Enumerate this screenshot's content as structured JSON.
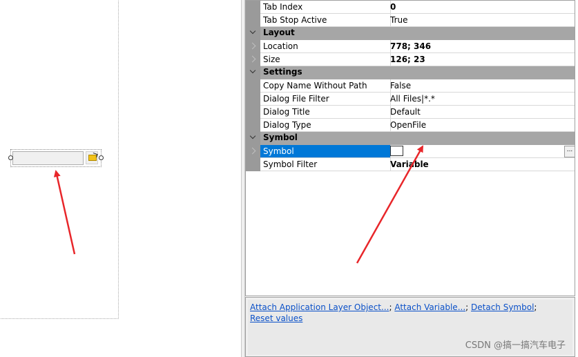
{
  "properties": {
    "rows": [
      {
        "kind": "prop",
        "name": "Tab Index",
        "value": "0",
        "bold": true
      },
      {
        "kind": "prop",
        "name": "Tab Stop Active",
        "value": "True",
        "bold": false
      },
      {
        "kind": "category",
        "name": "Layout"
      },
      {
        "kind": "prop",
        "name": "Location",
        "value": "778; 346",
        "bold": true,
        "expandable": true
      },
      {
        "kind": "prop",
        "name": "Size",
        "value": "126; 23",
        "bold": true,
        "expandable": true
      },
      {
        "kind": "category",
        "name": "Settings"
      },
      {
        "kind": "prop",
        "name": "Copy Name Without Path",
        "value": "False",
        "bold": false
      },
      {
        "kind": "prop",
        "name": "Dialog File Filter",
        "value": "All Files|*.*",
        "bold": false
      },
      {
        "kind": "prop",
        "name": "Dialog Title",
        "value": "Default",
        "bold": false
      },
      {
        "kind": "prop",
        "name": "Dialog Type",
        "value": "OpenFile",
        "bold": false
      },
      {
        "kind": "category",
        "name": "Symbol"
      },
      {
        "kind": "prop",
        "name": "Symbol",
        "value": "",
        "bold": false,
        "expandable": true,
        "selected": true,
        "swatch": true
      },
      {
        "kind": "prop",
        "name": "Symbol Filter",
        "value": "Variable",
        "bold": true
      }
    ]
  },
  "ellipsis_label": "...",
  "commands": {
    "links": [
      "Attach Application Layer Object...",
      "Attach Variable...",
      "Detach Symbol",
      "Reset values"
    ],
    "separator": ";"
  },
  "watermark": "CSDN @搞一搞汽车电子",
  "colors": {
    "arrow": "#e8262a",
    "selection": "#0078d7",
    "category_band": "#a6a6a6"
  }
}
